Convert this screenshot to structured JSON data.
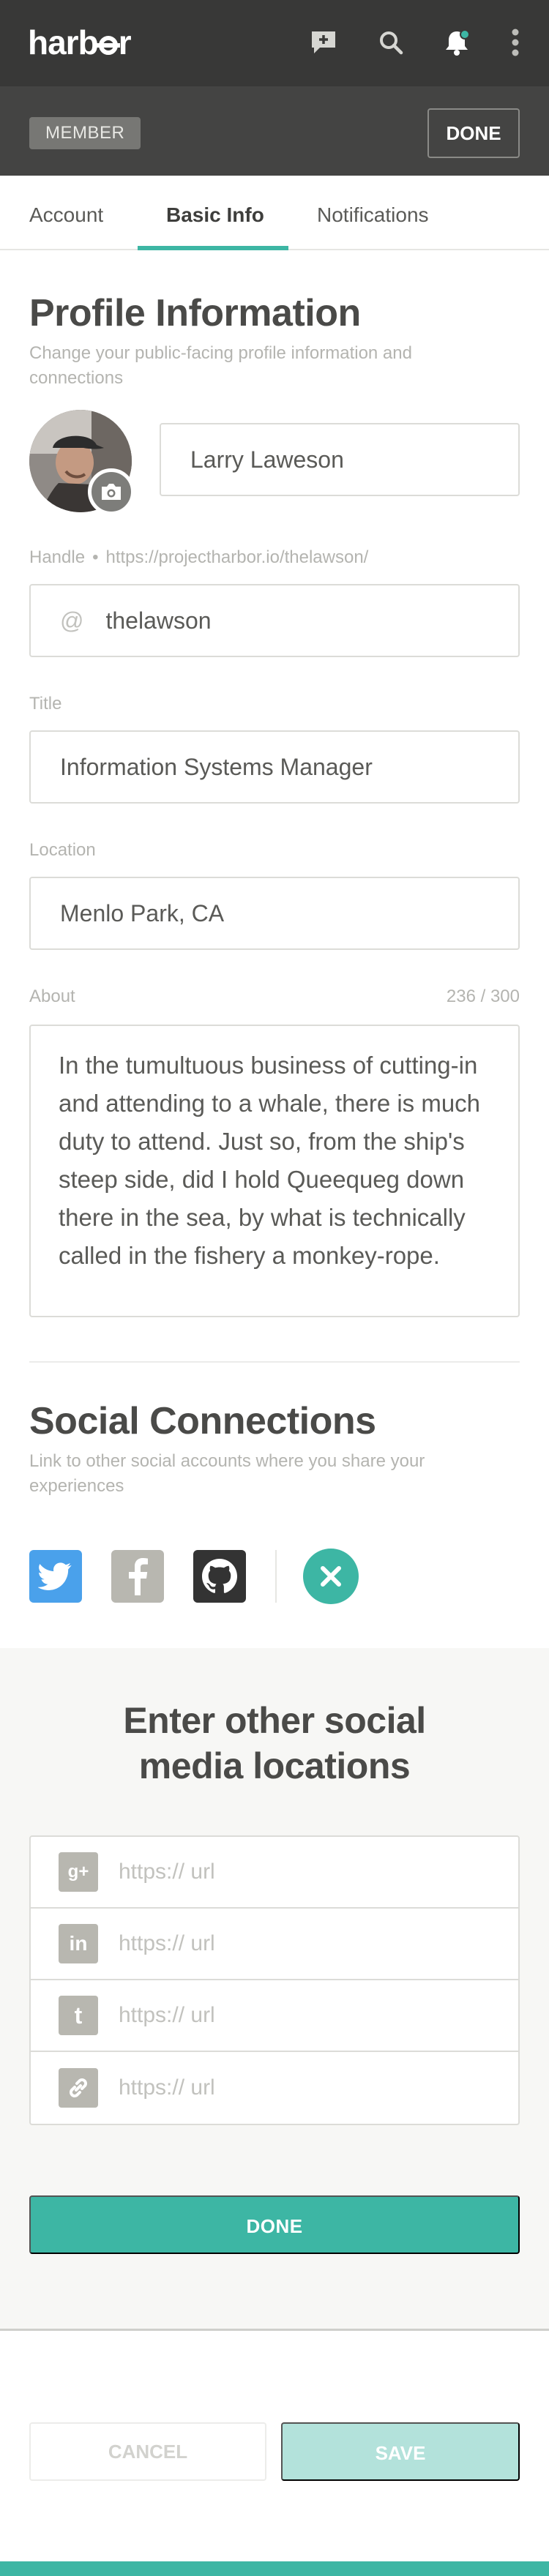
{
  "app": {
    "logo": "harbor"
  },
  "topbar": {
    "icons": [
      "add-comment-icon",
      "search-icon",
      "bell-icon",
      "more-vertical-icon"
    ]
  },
  "memberbar": {
    "badge": "MEMBER",
    "done": "DONE"
  },
  "tabs": [
    {
      "label": "Account"
    },
    {
      "label": "Basic Info",
      "active": true
    },
    {
      "label": "Notifications"
    }
  ],
  "profile": {
    "title": "Profile Information",
    "subtitle": "Change your public-facing profile information and connections",
    "name": "Larry Laweson",
    "handle_label": "Handle",
    "handle_url": "https://projectharbor.io/thelawson/",
    "handle_prefix": "@",
    "handle": "thelawson",
    "title_label": "Title",
    "job_title": "Information Systems Manager",
    "location_label": "Location",
    "location": "Menlo Park, CA",
    "about_label": "About",
    "about_count": "236 / 300",
    "about": "In the tumultuous business of cutting-in and attending to a whale, there is much duty to attend. Just so, from the ship's steep side, did I hold Queequeg down there in the sea, by what is technically called in the fishery a monkey-rope."
  },
  "social": {
    "title": "Social Connections",
    "subtitle": "Link to other social accounts where you share your experiences",
    "icons": [
      "twitter-icon",
      "facebook-icon",
      "github-icon",
      "close-icon"
    ],
    "colors": {
      "twitter": "#4aa1eb",
      "facebook": "#b8b7b0",
      "github": "#333333",
      "accent": "#3db6a4"
    }
  },
  "other": {
    "title": "Enter other social media locations",
    "rows": [
      {
        "icon": "google-plus-icon",
        "glyph": "g+",
        "placeholder": "https://  url"
      },
      {
        "icon": "linkedin-icon",
        "glyph": "in",
        "placeholder": "https://  url"
      },
      {
        "icon": "tumblr-icon",
        "glyph": "t",
        "placeholder": "https://  url"
      },
      {
        "icon": "link-icon",
        "glyph": "",
        "placeholder": "https://  url"
      }
    ],
    "done": "DONE"
  },
  "footer": {
    "cancel": "CANCEL",
    "save": "SAVE"
  }
}
